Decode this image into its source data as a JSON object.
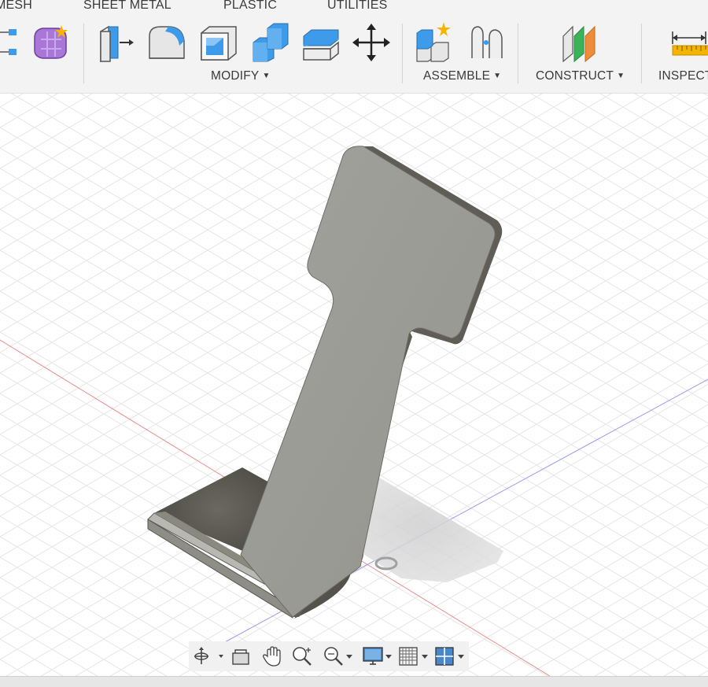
{
  "tabs": [
    "MESH",
    "SHEET METAL",
    "PLASTIC",
    "UTILITIES"
  ],
  "groups": {
    "modify": "MODIFY",
    "assemble": "ASSEMBLE",
    "construct": "CONSTRUCT",
    "inspect": "INSPECT"
  },
  "icons": {
    "mesh": [
      "mesh-tool-icon",
      "create-form-icon"
    ],
    "modify": [
      "press-pull-icon",
      "fillet-icon",
      "shell-icon",
      "combine-icon",
      "offset-face-icon",
      "move-copy-icon"
    ],
    "assemble": [
      "new-component-icon",
      "joint-icon"
    ],
    "construct": [
      "offset-plane-icon"
    ],
    "inspect": [
      "measure-icon"
    ]
  },
  "navbar_icons": [
    "orbit-icon",
    "look-at-icon",
    "pan-icon",
    "zoom-icon",
    "fit-icon",
    "display-settings-icon",
    "grid-settings-icon",
    "viewports-icon"
  ],
  "colors": {
    "toolbar_bg": "#f3f3f3",
    "accent_blue": "#3d9be9",
    "grid_line": "#e6e6e6",
    "axis_red": "#e88c8c",
    "axis_blue": "#9c9cf0",
    "body_face": "#9d9d97",
    "body_dark": "#55534c"
  }
}
